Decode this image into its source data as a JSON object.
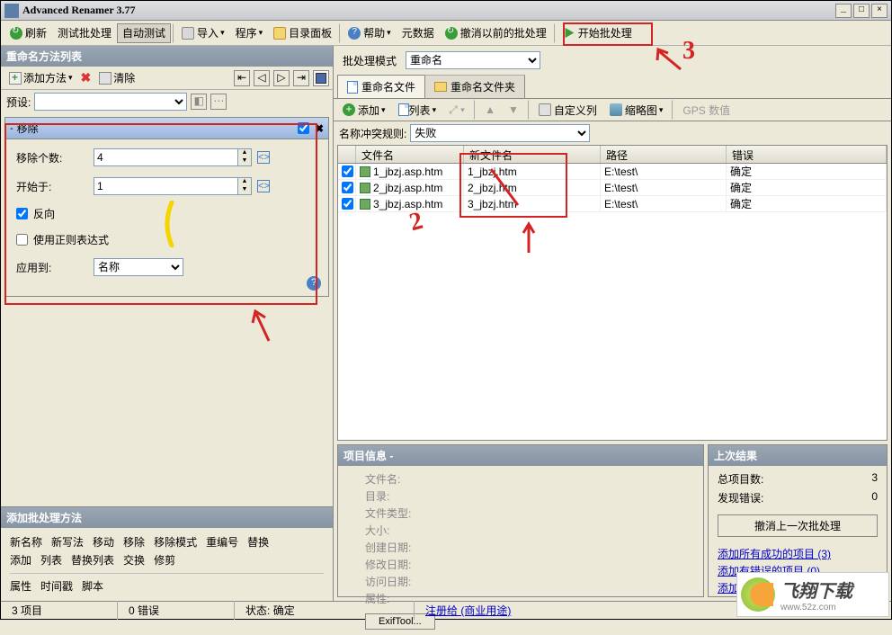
{
  "window": {
    "title": "Advanced Renamer 3.77"
  },
  "toolbar": {
    "refresh": "刷新",
    "test": "测试批处理",
    "autotest": "自动测试",
    "import": "导入",
    "program": "程序",
    "dirpanel": "目录面板",
    "help": "帮助",
    "metadata": "元数据",
    "undo": "撤消以前的批处理",
    "start": "开始批处理"
  },
  "left": {
    "title": "重命名方法列表",
    "addMethod": "添加方法",
    "clear": "清除",
    "preset": "预设:",
    "method": {
      "title": "移除",
      "count_label": "移除个数:",
      "count_value": "4",
      "start_label": "开始于:",
      "start_value": "1",
      "reverse": "反向",
      "regex": "使用正则表达式",
      "applyto_label": "应用到:",
      "applyto_value": "名称"
    },
    "addSection": {
      "title": "添加批处理方法",
      "row1": [
        "新名称",
        "新写法",
        "移动",
        "移除",
        "移除模式",
        "重编号",
        "替换"
      ],
      "row2": [
        "添加",
        "列表",
        "替换列表",
        "交换",
        "修剪"
      ],
      "row3": [
        "属性",
        "时间戳",
        "脚本"
      ]
    }
  },
  "right": {
    "mode_label": "批处理模式",
    "mode_value": "重命名",
    "tab1": "重命名文件",
    "tab2": "重命名文件夹",
    "tb": {
      "add": "添加",
      "list": "列表",
      "cols": "自定义列",
      "thumb": "缩略图",
      "gps": "GPS 数值"
    },
    "conflict_label": "名称冲突规则:",
    "conflict_value": "失败",
    "cols": {
      "c1": "文件名",
      "c2": "新文件名",
      "c3": "路径",
      "c4": "错误"
    },
    "rows": [
      {
        "fn": "1_jbzj.asp.htm",
        "nn": "1_jbzj.htm",
        "path": "E:\\test\\",
        "err": "确定"
      },
      {
        "fn": "2_jbzj.asp.htm",
        "nn": "2_jbzj.htm",
        "path": "E:\\test\\",
        "err": "确定"
      },
      {
        "fn": "3_jbzj.asp.htm",
        "nn": "3_jbzj.htm",
        "path": "E:\\test\\",
        "err": "确定"
      }
    ],
    "info": {
      "title": "项目信息 -",
      "labels": [
        "文件名:",
        "目录:",
        "文件类型:",
        "大小:",
        "创建日期:",
        "修改日期:",
        "访问日期:",
        "属性:"
      ],
      "exif": "ExifTool..."
    },
    "result": {
      "title": "上次结果",
      "total_l": "总项目数:",
      "total_v": "3",
      "err_l": "发现错误:",
      "err_v": "0",
      "undo_btn": "撤消上一次批处理",
      "link1": "添加所有成功的项目 (3)",
      "link2": "添加有错误的项目 (0)",
      "link3": "添加所有项目 (3)"
    }
  },
  "status": {
    "s1": "3 项目",
    "s2": "0 错误",
    "s3_l": "状态:",
    "s3_v": "确定",
    "s4": "注册给 (商业用途)"
  },
  "logo": {
    "name": "飞翔下载",
    "url": "www.52z.com"
  }
}
